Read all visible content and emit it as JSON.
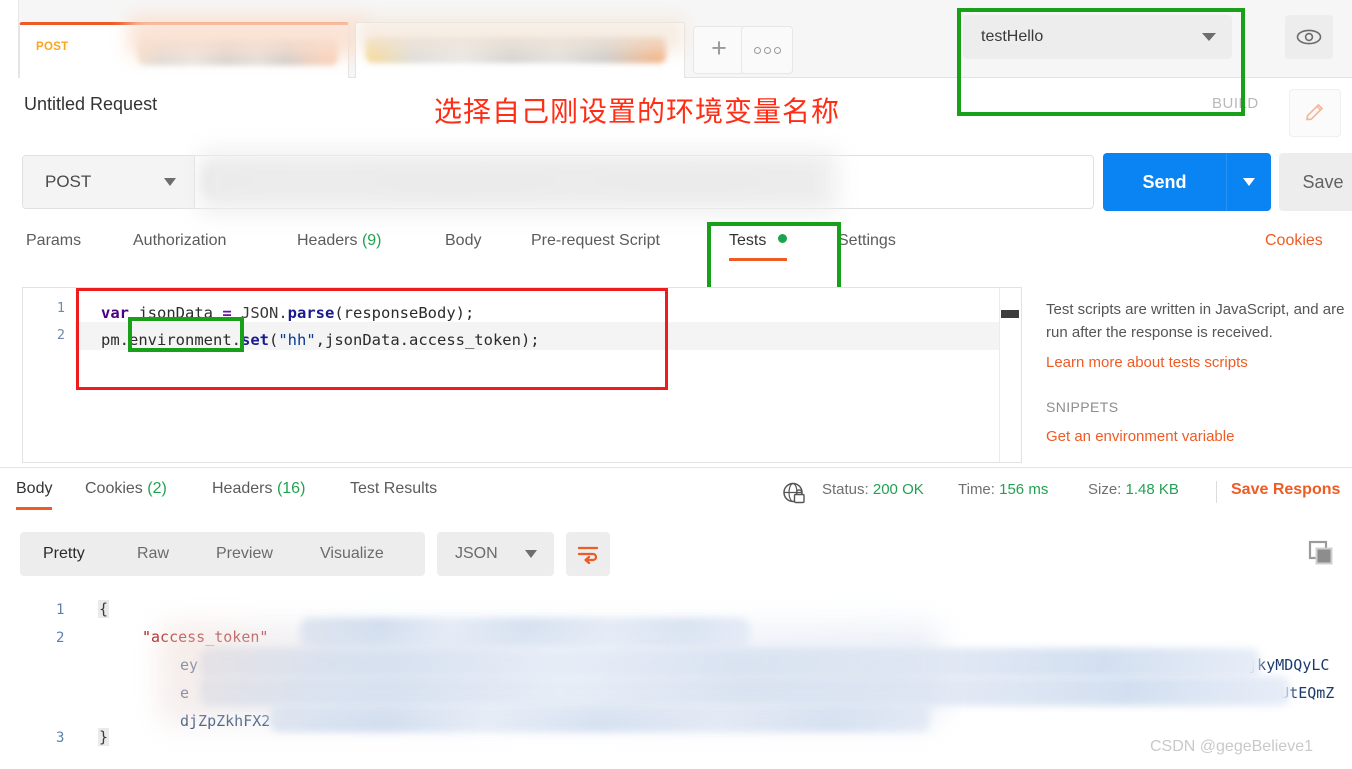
{
  "window": {
    "tabs": [
      {
        "method": "POST",
        "title_redacted": true
      },
      {
        "method": "",
        "title_redacted": true
      }
    ],
    "add_tab_label": "+",
    "more_label": "000"
  },
  "environment": {
    "selected": "testHello",
    "caret_icon": "chevron-down-icon",
    "eye_icon": "eye-icon",
    "edit_icon": "pencil-icon",
    "build_label": "BUILD"
  },
  "annotation": {
    "chinese_note": "选择自己刚设置的环境变量名称",
    "note_color": "#ff2d16",
    "box_green": "#18a018",
    "box_red": "#ee1c1c"
  },
  "request": {
    "title": "Untitled Request",
    "method": "POST",
    "url_redacted": true,
    "send_label": "Send",
    "save_label": "Save",
    "tabs": [
      {
        "label": "Params",
        "count": "",
        "selected": false
      },
      {
        "label": "Authorization",
        "count": "",
        "selected": false
      },
      {
        "label": "Headers",
        "count": "(9)",
        "selected": false
      },
      {
        "label": "Body",
        "count": "",
        "selected": false
      },
      {
        "label": "Pre-request Script",
        "count": "",
        "selected": false
      },
      {
        "label": "Tests",
        "count": "",
        "selected": true,
        "dot": true
      },
      {
        "label": "Settings",
        "count": "",
        "selected": false
      }
    ],
    "cookies_link": "Cookies"
  },
  "editor": {
    "lines": [
      "1",
      "2"
    ],
    "line1": {
      "kw": "var",
      "name": " jsonData ",
      "eq": "=",
      "obj": " JSON.",
      "fn": "parse",
      "args": "(responseBody);"
    },
    "line2": {
      "pm": "pm.",
      "env": "environment",
      "dot": ".",
      "fn": "set",
      "open": "(",
      "str": "\"hh\"",
      "rest": ",jsonData.access_token);"
    },
    "full_line1": "var jsonData = JSON.parse(responseBody);",
    "full_line2": "pm.environment.set(\"hh\",jsonData.access_token);"
  },
  "help": {
    "description": "Test scripts are written in JavaScript, and are run after the response is received.",
    "learn_link": "Learn more about tests scripts",
    "snippets_header": "SNIPPETS",
    "snippet_1": "Get an environment variable"
  },
  "response": {
    "tabs": [
      {
        "label": "Body",
        "count": "",
        "selected": true
      },
      {
        "label": "Cookies",
        "count": "(2)",
        "selected": false
      },
      {
        "label": "Headers",
        "count": "(16)",
        "selected": false
      },
      {
        "label": "Test Results",
        "count": "",
        "selected": false
      }
    ],
    "lock_icon": "globe-lock-icon",
    "status_label": "Status:",
    "status_value": "200 OK",
    "time_label": "Time:",
    "time_value": "156 ms",
    "size_label": "Size:",
    "size_value": "1.48 KB",
    "save_response": "Save Respons",
    "format_tabs": [
      {
        "label": "Pretty",
        "selected": true
      },
      {
        "label": "Raw",
        "selected": false
      },
      {
        "label": "Preview",
        "selected": false
      },
      {
        "label": "Visualize",
        "selected": false
      }
    ],
    "content_type": "JSON",
    "wrap_icon": "wrap-lines-icon",
    "copy_icon": "copy-icon",
    "body": {
      "lines": [
        "1",
        "2",
        "3"
      ],
      "line1": "{",
      "line2_key": "\"access_token\"",
      "line2_tail": "'iJ9.",
      "line3_frag": "ey",
      "line4_frag": "e",
      "line5_frag": "djZpZkhFX2",
      "right_frag_1": "NiOxMjkyMDQyLC",
      "right_frag_2": "VUVSSUtEQmZ",
      "line6": "}"
    }
  },
  "watermark": "CSDN @gegeBelieve1"
}
